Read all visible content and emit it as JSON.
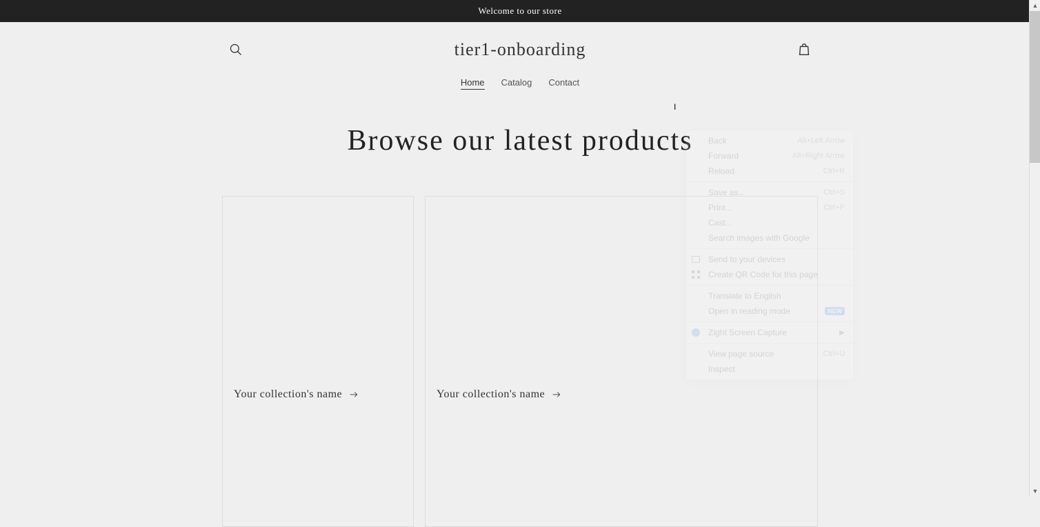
{
  "announcement": "Welcome to our store",
  "store_name": "tier1-onboarding",
  "nav": {
    "home": "Home",
    "catalog": "Catalog",
    "contact": "Contact"
  },
  "hero_heading": "Browse our latest products",
  "collections": [
    {
      "label": "Your collection's name"
    },
    {
      "label": "Your collection's name"
    }
  ],
  "context_menu": {
    "back": {
      "label": "Back",
      "shortcut": "Alt+Left Arrow"
    },
    "forward": {
      "label": "Forward",
      "shortcut": "Alt+Right Arrow"
    },
    "reload": {
      "label": "Reload",
      "shortcut": "Ctrl+R"
    },
    "save_as": {
      "label": "Save as...",
      "shortcut": "Ctrl+S"
    },
    "print": {
      "label": "Print...",
      "shortcut": "Ctrl+P"
    },
    "cast": {
      "label": "Cast..."
    },
    "search_images": {
      "label": "Search images with Google"
    },
    "send_to_devices": {
      "label": "Send to your devices"
    },
    "create_qr": {
      "label": "Create QR Code for this page"
    },
    "translate": {
      "label": "Translate to English"
    },
    "open_reading": {
      "label": "Open in reading mode",
      "badge": "NEW"
    },
    "zight": {
      "label": "Zight Screen Capture"
    },
    "view_source": {
      "label": "View page source",
      "shortcut": "Ctrl+U"
    },
    "inspect": {
      "label": "Inspect"
    }
  }
}
